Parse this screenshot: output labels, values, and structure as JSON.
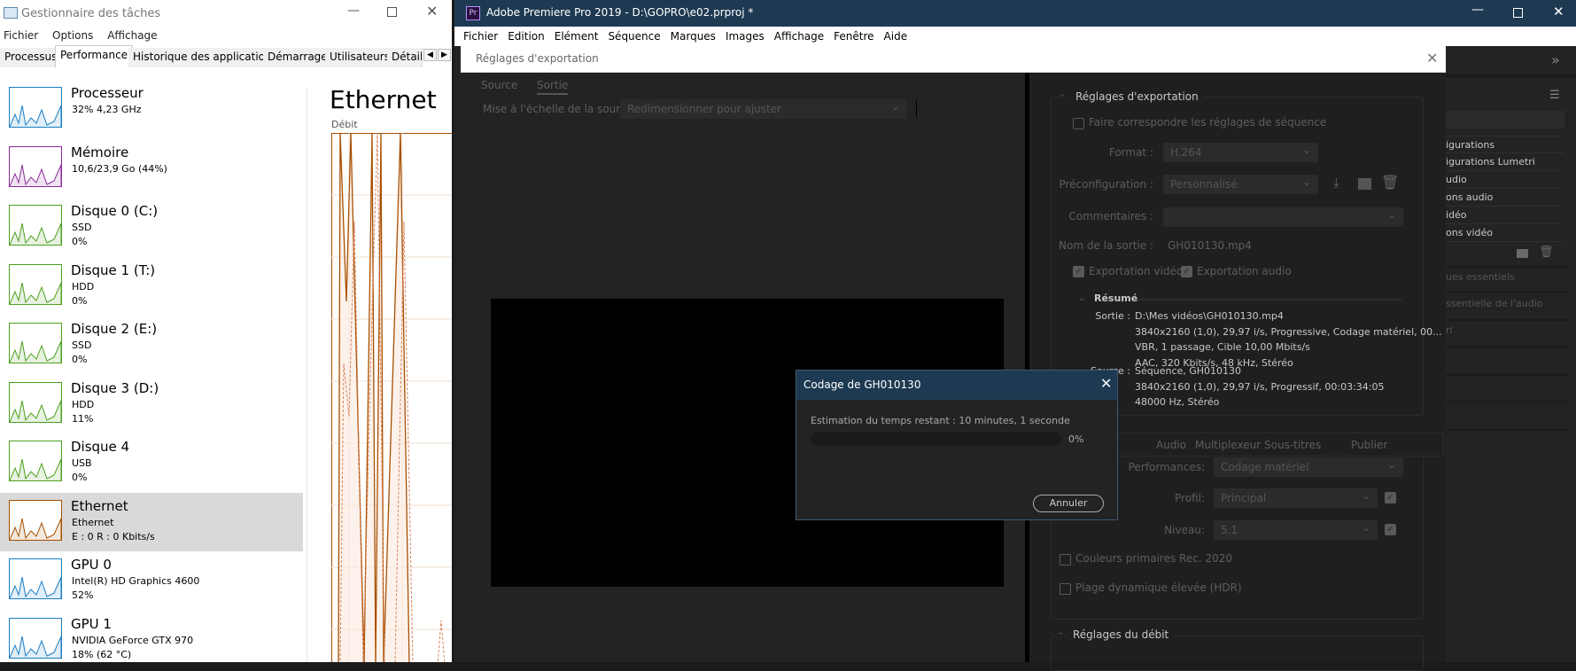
{
  "task_manager": {
    "title": "Gestionnaire des tâches",
    "menu": [
      "Fichier",
      "Options",
      "Affichage"
    ],
    "tabs": [
      "Processus",
      "Performance",
      "Historique des applications",
      "Démarrage",
      "Utilisateurs",
      "Détail"
    ],
    "items": [
      {
        "name": "Processeur",
        "sub1": "32% 4,23 GHz",
        "sub2": "",
        "color": "#1a7dc4"
      },
      {
        "name": "Mémoire",
        "sub1": "10,6/23,9 Go (44%)",
        "sub2": "",
        "color": "#8b2a9b"
      },
      {
        "name": "Disque 0 (C:)",
        "sub1": "SSD",
        "sub2": "0%",
        "color": "#4da01e"
      },
      {
        "name": "Disque 1 (T:)",
        "sub1": "HDD",
        "sub2": "0%",
        "color": "#4da01e"
      },
      {
        "name": "Disque 2 (E:)",
        "sub1": "SSD",
        "sub2": "0%",
        "color": "#4da01e"
      },
      {
        "name": "Disque 3 (D:)",
        "sub1": "HDD",
        "sub2": "11%",
        "color": "#4da01e"
      },
      {
        "name": "Disque 4",
        "sub1": "USB",
        "sub2": "0%",
        "color": "#4da01e"
      },
      {
        "name": "Ethernet",
        "sub1": "Ethernet",
        "sub2": "E : 0 R : 0 Kbits/s",
        "color": "#a74f01"
      },
      {
        "name": "GPU 0",
        "sub1": "Intel(R) HD Graphics 4600",
        "sub2": "52%",
        "color": "#1a7dc4"
      },
      {
        "name": "GPU 1",
        "sub1": "NVIDIA GeForce GTX 970",
        "sub2": "18% (62 °C)",
        "color": "#1a7dc4"
      }
    ],
    "detail_title": "Ethernet",
    "detail_label": "Débit"
  },
  "premiere": {
    "title": "Adobe Premiere Pro 2019 - D:\\GOPRO\\e02.prproj *",
    "logo": "Pr",
    "menu": [
      "Fichier",
      "Edition",
      "Elément",
      "Séquence",
      "Marques",
      "Images",
      "Affichage",
      "Fenêtre",
      "Aide"
    ],
    "panel_items": [
      "igurations",
      "igurations Lumetri",
      "udio",
      "ons audio",
      "idéo",
      "ons vidéo"
    ],
    "panel_more": [
      "ues essentiels",
      "ssentielle de l'audio",
      "ri"
    ]
  },
  "export": {
    "title": "Réglages d'exportation",
    "tabs": [
      "Source",
      "Sortie"
    ],
    "scale_label": "Mise à l'échelle de la source :",
    "scale_value": "Redimensionner pour ajuster",
    "section": "Réglages d'exportation",
    "match_seq": "Faire correspondre les réglages de séquence",
    "format_label": "Format :",
    "format_value": "H.264",
    "preset_label": "Préconfiguration :",
    "preset_value": "Personnalisé",
    "comments_label": "Commentaires :",
    "comments_value": "",
    "output_label": "Nom de la sortie :",
    "output_value": "GH010130.mp4",
    "export_video": "Exportation vidéo",
    "export_audio": "Exportation audio",
    "summary": "Résumé",
    "out_label": "Sortie :",
    "out_lines": [
      "D:\\Mes vidéos\\GH010130.mp4",
      "3840x2160 (1,0), 29,97 i/s, Progressive, Codage matériel, 00...",
      "VBR, 1 passage, Cible 10,00  Mbits/s",
      "AAC, 320  Kbits/s, 48  kHz, Stéréo"
    ],
    "src_label": "Source :",
    "src_lines": [
      "Séquence, GH010130",
      "3840x2160 (1,0), 29,97  i/s, Progressif, 00:03:34:05",
      "48000 Hz, Stéréo"
    ],
    "sub_tabs": [
      "Audio",
      "Multiplexeur",
      "Sous-titres",
      "Publier"
    ],
    "perf_label": "Performances:",
    "perf_value": "Codage matériel",
    "profile_label": "Profil:",
    "profile_value": "Principal",
    "level_label": "Niveau:",
    "level_value": "5.1",
    "rec2020": "Couleurs primaires Rec. 2020",
    "hdr": "Plage dynamique élevée (HDR)",
    "bitrate_section": "Réglages du débit"
  },
  "encoding": {
    "title": "Codage de GH010130",
    "estimate": "Estimation du temps restant : 10 minutes, 1 seconde",
    "progress": 0,
    "progress_text": "0%",
    "cancel": "Annuler"
  }
}
